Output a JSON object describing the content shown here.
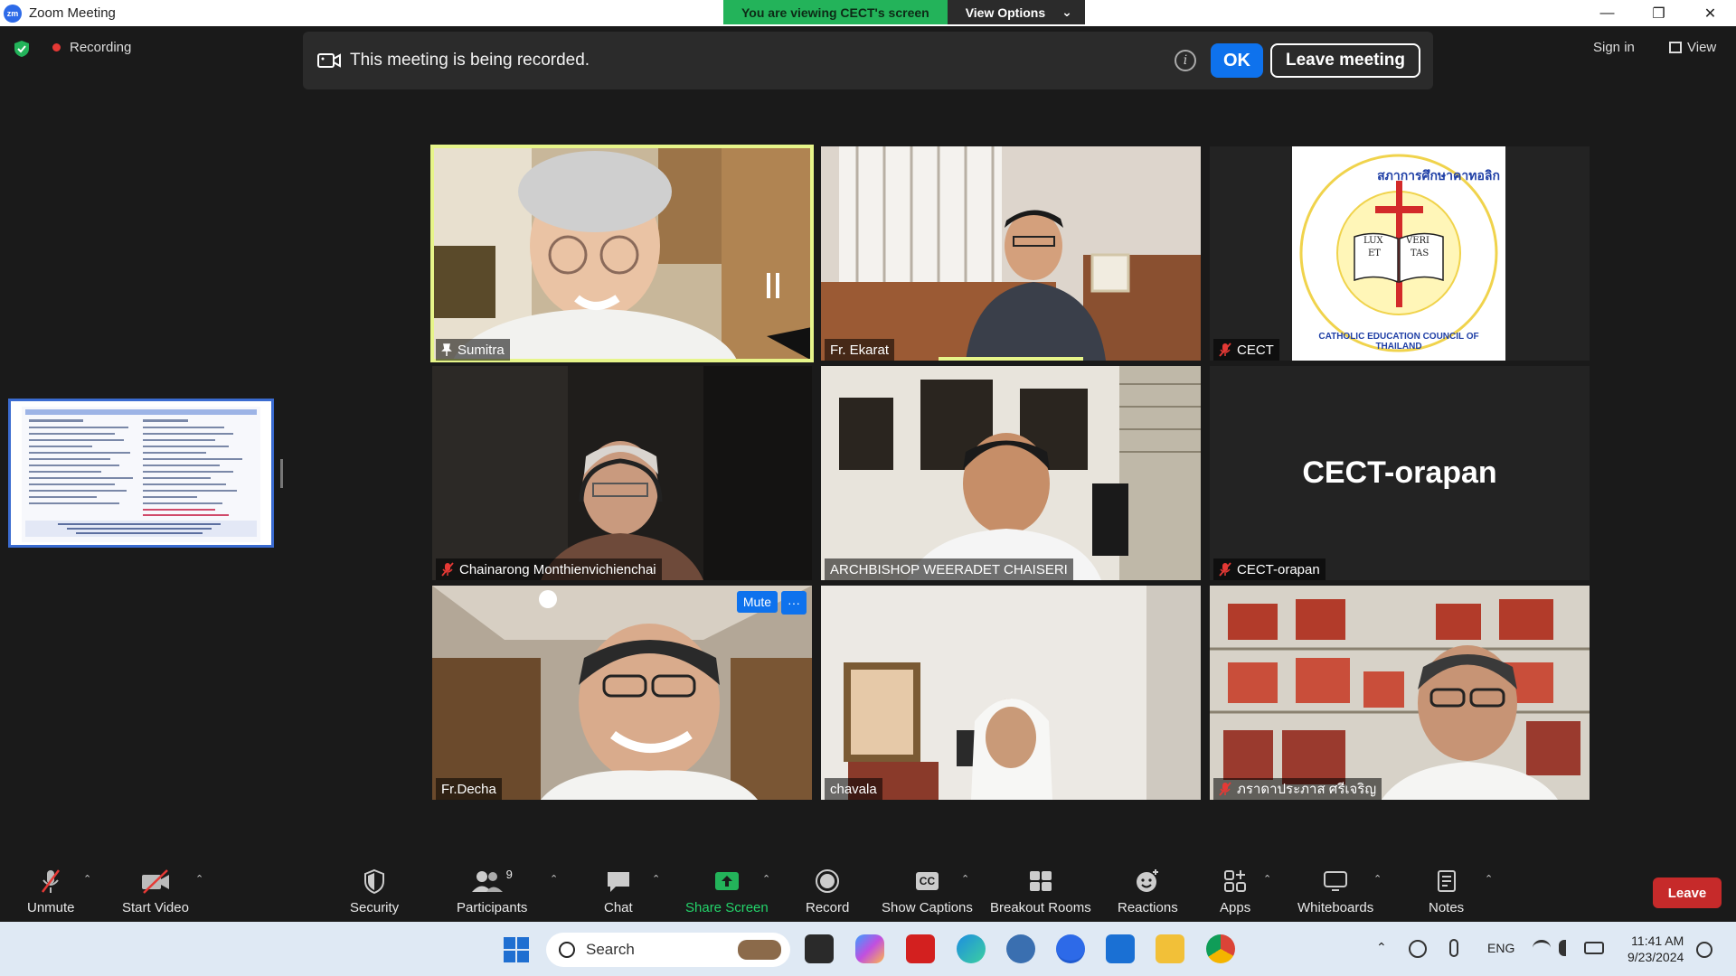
{
  "window": {
    "app_icon_text": "zm",
    "title": "Zoom Meeting",
    "minimize": "—",
    "restore": "❐",
    "close": "✕"
  },
  "share_banner": {
    "viewing_text": "You are viewing CECT's screen",
    "view_options_label": "View Options",
    "chevron": "⌄"
  },
  "meeting_top": {
    "recording_label": "Recording",
    "sign_in_label": "Sign in",
    "view_label": "View"
  },
  "recording_notice": {
    "message": "This meeting is being recorded.",
    "info_glyph": "i",
    "ok_label": "OK",
    "leave_meeting_label": "Leave meeting"
  },
  "participants_grid": [
    {
      "name": "Sumitra",
      "pinned": true,
      "muted": false,
      "active_speaker": true
    },
    {
      "name": "Fr. Ekarat",
      "pinned": false,
      "muted": false
    },
    {
      "name": "CECT",
      "pinned": false,
      "muted": true,
      "logo": "Catholic Education Council of Thailand seal"
    },
    {
      "name": "Chainarong Monthienvichienchai",
      "pinned": false,
      "muted": true
    },
    {
      "name": "ARCHBISHOP WEERADET CHAISERI",
      "pinned": false,
      "muted": false
    },
    {
      "name": "CECT-orapan",
      "pinned": false,
      "muted": true,
      "video_off_label": "CECT-orapan"
    },
    {
      "name": "Fr.Decha",
      "pinned": false,
      "muted": false,
      "hover_mute_label": "Mute",
      "hover_more_label": "···"
    },
    {
      "name": "chavala",
      "pinned": false,
      "muted": false
    },
    {
      "name": "ภราดาประภาส ศรีเจริญ",
      "pinned": false,
      "muted": true
    }
  ],
  "seal": {
    "top_text": "สภาการศึกษาคาทอลิก",
    "ring_text": "CATHOLIC EDUCATION COUNCIL OF THAILAND",
    "book_left_top": "LUX",
    "book_left_bottom": "ET",
    "book_right_top": "VERI",
    "book_right_bottom": "TAS"
  },
  "toolbar": {
    "unmute": "Unmute",
    "start_video": "Start Video",
    "security": "Security",
    "participants": "Participants",
    "participants_count": "9",
    "chat": "Chat",
    "share_screen": "Share Screen",
    "record": "Record",
    "show_captions": "Show Captions",
    "captions_badge": "CC",
    "breakout_rooms": "Breakout Rooms",
    "reactions": "Reactions",
    "apps": "Apps",
    "whiteboards": "Whiteboards",
    "notes": "Notes",
    "leave": "Leave",
    "caret": "⌃"
  },
  "taskbar": {
    "search_placeholder": "Search",
    "language": "ENG",
    "time": "11:41 AM",
    "date": "9/23/2024"
  },
  "colors": {
    "zoom_blue": "#0e72ed",
    "share_green": "#23b35a",
    "leave_red": "#c62a2a",
    "active_speaker": "#e7f58a"
  }
}
